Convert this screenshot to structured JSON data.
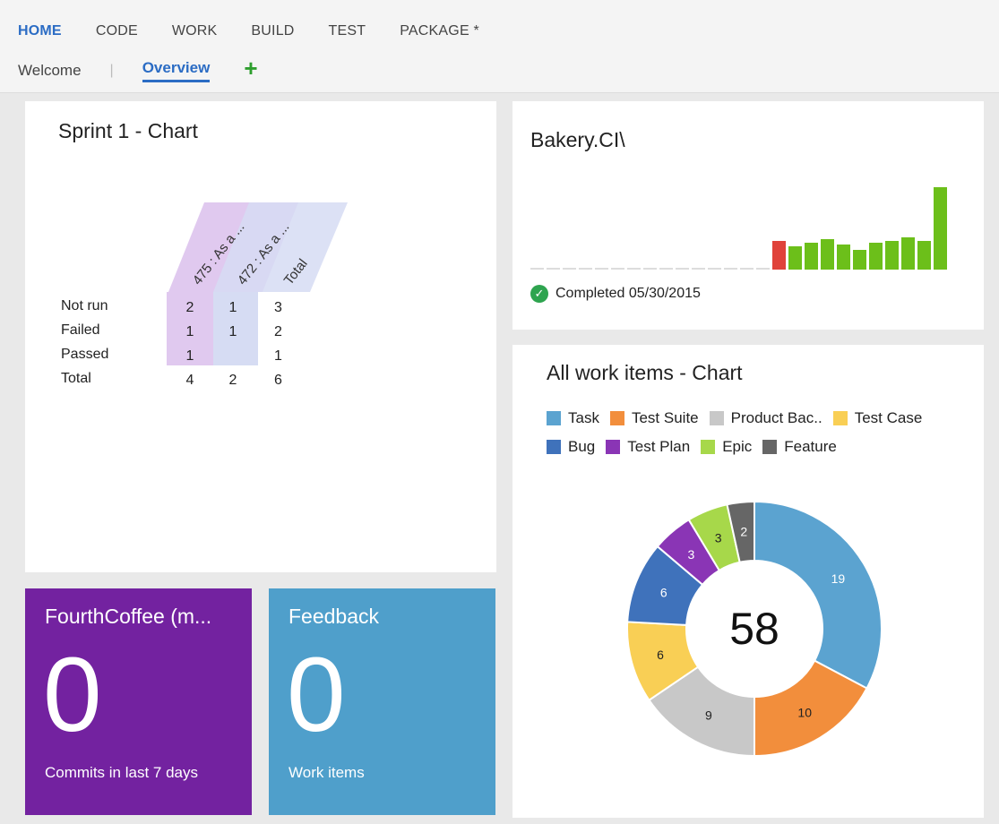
{
  "nav": {
    "hubs": [
      "HOME",
      "CODE",
      "WORK",
      "BUILD",
      "TEST",
      "PACKAGE *"
    ],
    "active_hub": "HOME",
    "subtabs": [
      "Welcome",
      "Overview"
    ],
    "active_subtab": "Overview",
    "add_icon": "plus-icon"
  },
  "sprint_chart": {
    "title": "Sprint 1 - Chart",
    "column_headers": [
      "475 : As a ...",
      "472 : As a ...",
      "Total"
    ],
    "rows": [
      {
        "label": "Not run",
        "c1": "2",
        "c2": "1",
        "total": "3"
      },
      {
        "label": "Failed",
        "c1": "1",
        "c2": "1",
        "total": "2"
      },
      {
        "label": "Passed",
        "c1": "1",
        "c2": "",
        "total": "1"
      },
      {
        "label": "Total",
        "c1": "4",
        "c2": "2",
        "total": "6"
      }
    ]
  },
  "bakery": {
    "title": "Bakery.CI\\",
    "status_text": "Completed 05/30/2015",
    "colors": {
      "empty": "#dcdcdc",
      "failed": "#e0423a",
      "success": "#6cbf1a"
    }
  },
  "work_items": {
    "title": "All work items - Chart",
    "total": "58",
    "legend": [
      {
        "name": "Task",
        "color": "#5ba3d0"
      },
      {
        "name": "Test Suite",
        "color": "#f28e3c"
      },
      {
        "name": "Product Bac..",
        "color": "#c8c8c8"
      },
      {
        "name": "Test Case",
        "color": "#f9cf55"
      },
      {
        "name": "Bug",
        "color": "#3f72bb"
      },
      {
        "name": "Test Plan",
        "color": "#8a35b5"
      },
      {
        "name": "Epic",
        "color": "#a7d84a"
      },
      {
        "name": "Feature",
        "color": "#666666"
      }
    ]
  },
  "chart_data": {
    "type": "pie",
    "title": "All work items - Chart",
    "categories": [
      "Task",
      "Test Suite",
      "Product Bac..",
      "Test Case",
      "Bug",
      "Test Plan",
      "Epic",
      "Feature"
    ],
    "values": [
      19,
      10,
      9,
      6,
      6,
      3,
      3,
      2
    ],
    "colors": [
      "#5ba3d0",
      "#f28e3c",
      "#c8c8c8",
      "#f9cf55",
      "#3f72bb",
      "#8a35b5",
      "#a7d84a",
      "#666666"
    ],
    "center_label": "58"
  },
  "coffee": {
    "title": "FourthCoffee (m...",
    "count": "0",
    "subtitle": "Commits in last 7 days"
  },
  "feedback": {
    "title": "Feedback",
    "count": "0",
    "subtitle": "Work items"
  }
}
